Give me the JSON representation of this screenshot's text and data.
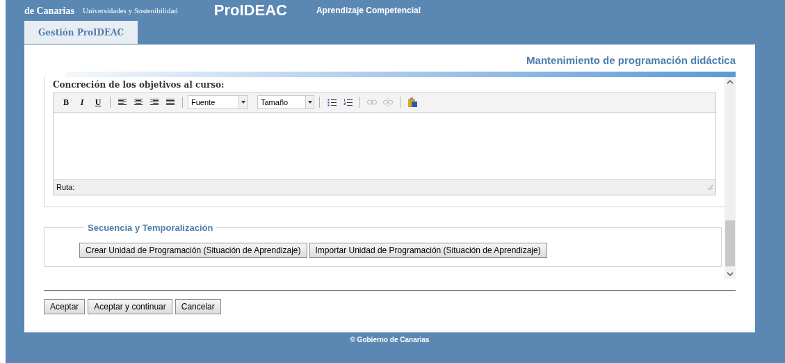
{
  "header": {
    "org_line": "de Canarias",
    "department": "Universidades y Sostenibilidad",
    "app_name": "ProIDEAC",
    "app_subtitle": "Aprendizaje Competencial"
  },
  "tabs": [
    {
      "label": "Gestión ProIDEAC",
      "selected": true
    }
  ],
  "page_title": "Mantenimiento de programación didáctica",
  "editor": {
    "label": "Concreción de los objetivos al curso:",
    "format_buttons": [
      {
        "kind": "bold",
        "glyph": "B"
      },
      {
        "kind": "italic",
        "glyph": "I"
      },
      {
        "kind": "underline",
        "glyph": "U"
      }
    ],
    "font_select": "Fuente",
    "size_select": "Tamaño",
    "path_label": "Ruta:"
  },
  "section": {
    "legend": "Secuencia y Temporalización",
    "buttons": [
      "Crear Unidad de Programación (Situación de Aprendizaje)",
      "Importar Unidad de Programación (Situación de Aprendizaje)"
    ]
  },
  "actions": [
    "Aceptar",
    "Aceptar y continuar",
    "Cancelar"
  ],
  "footer": "© Gobierno de Canarias"
}
